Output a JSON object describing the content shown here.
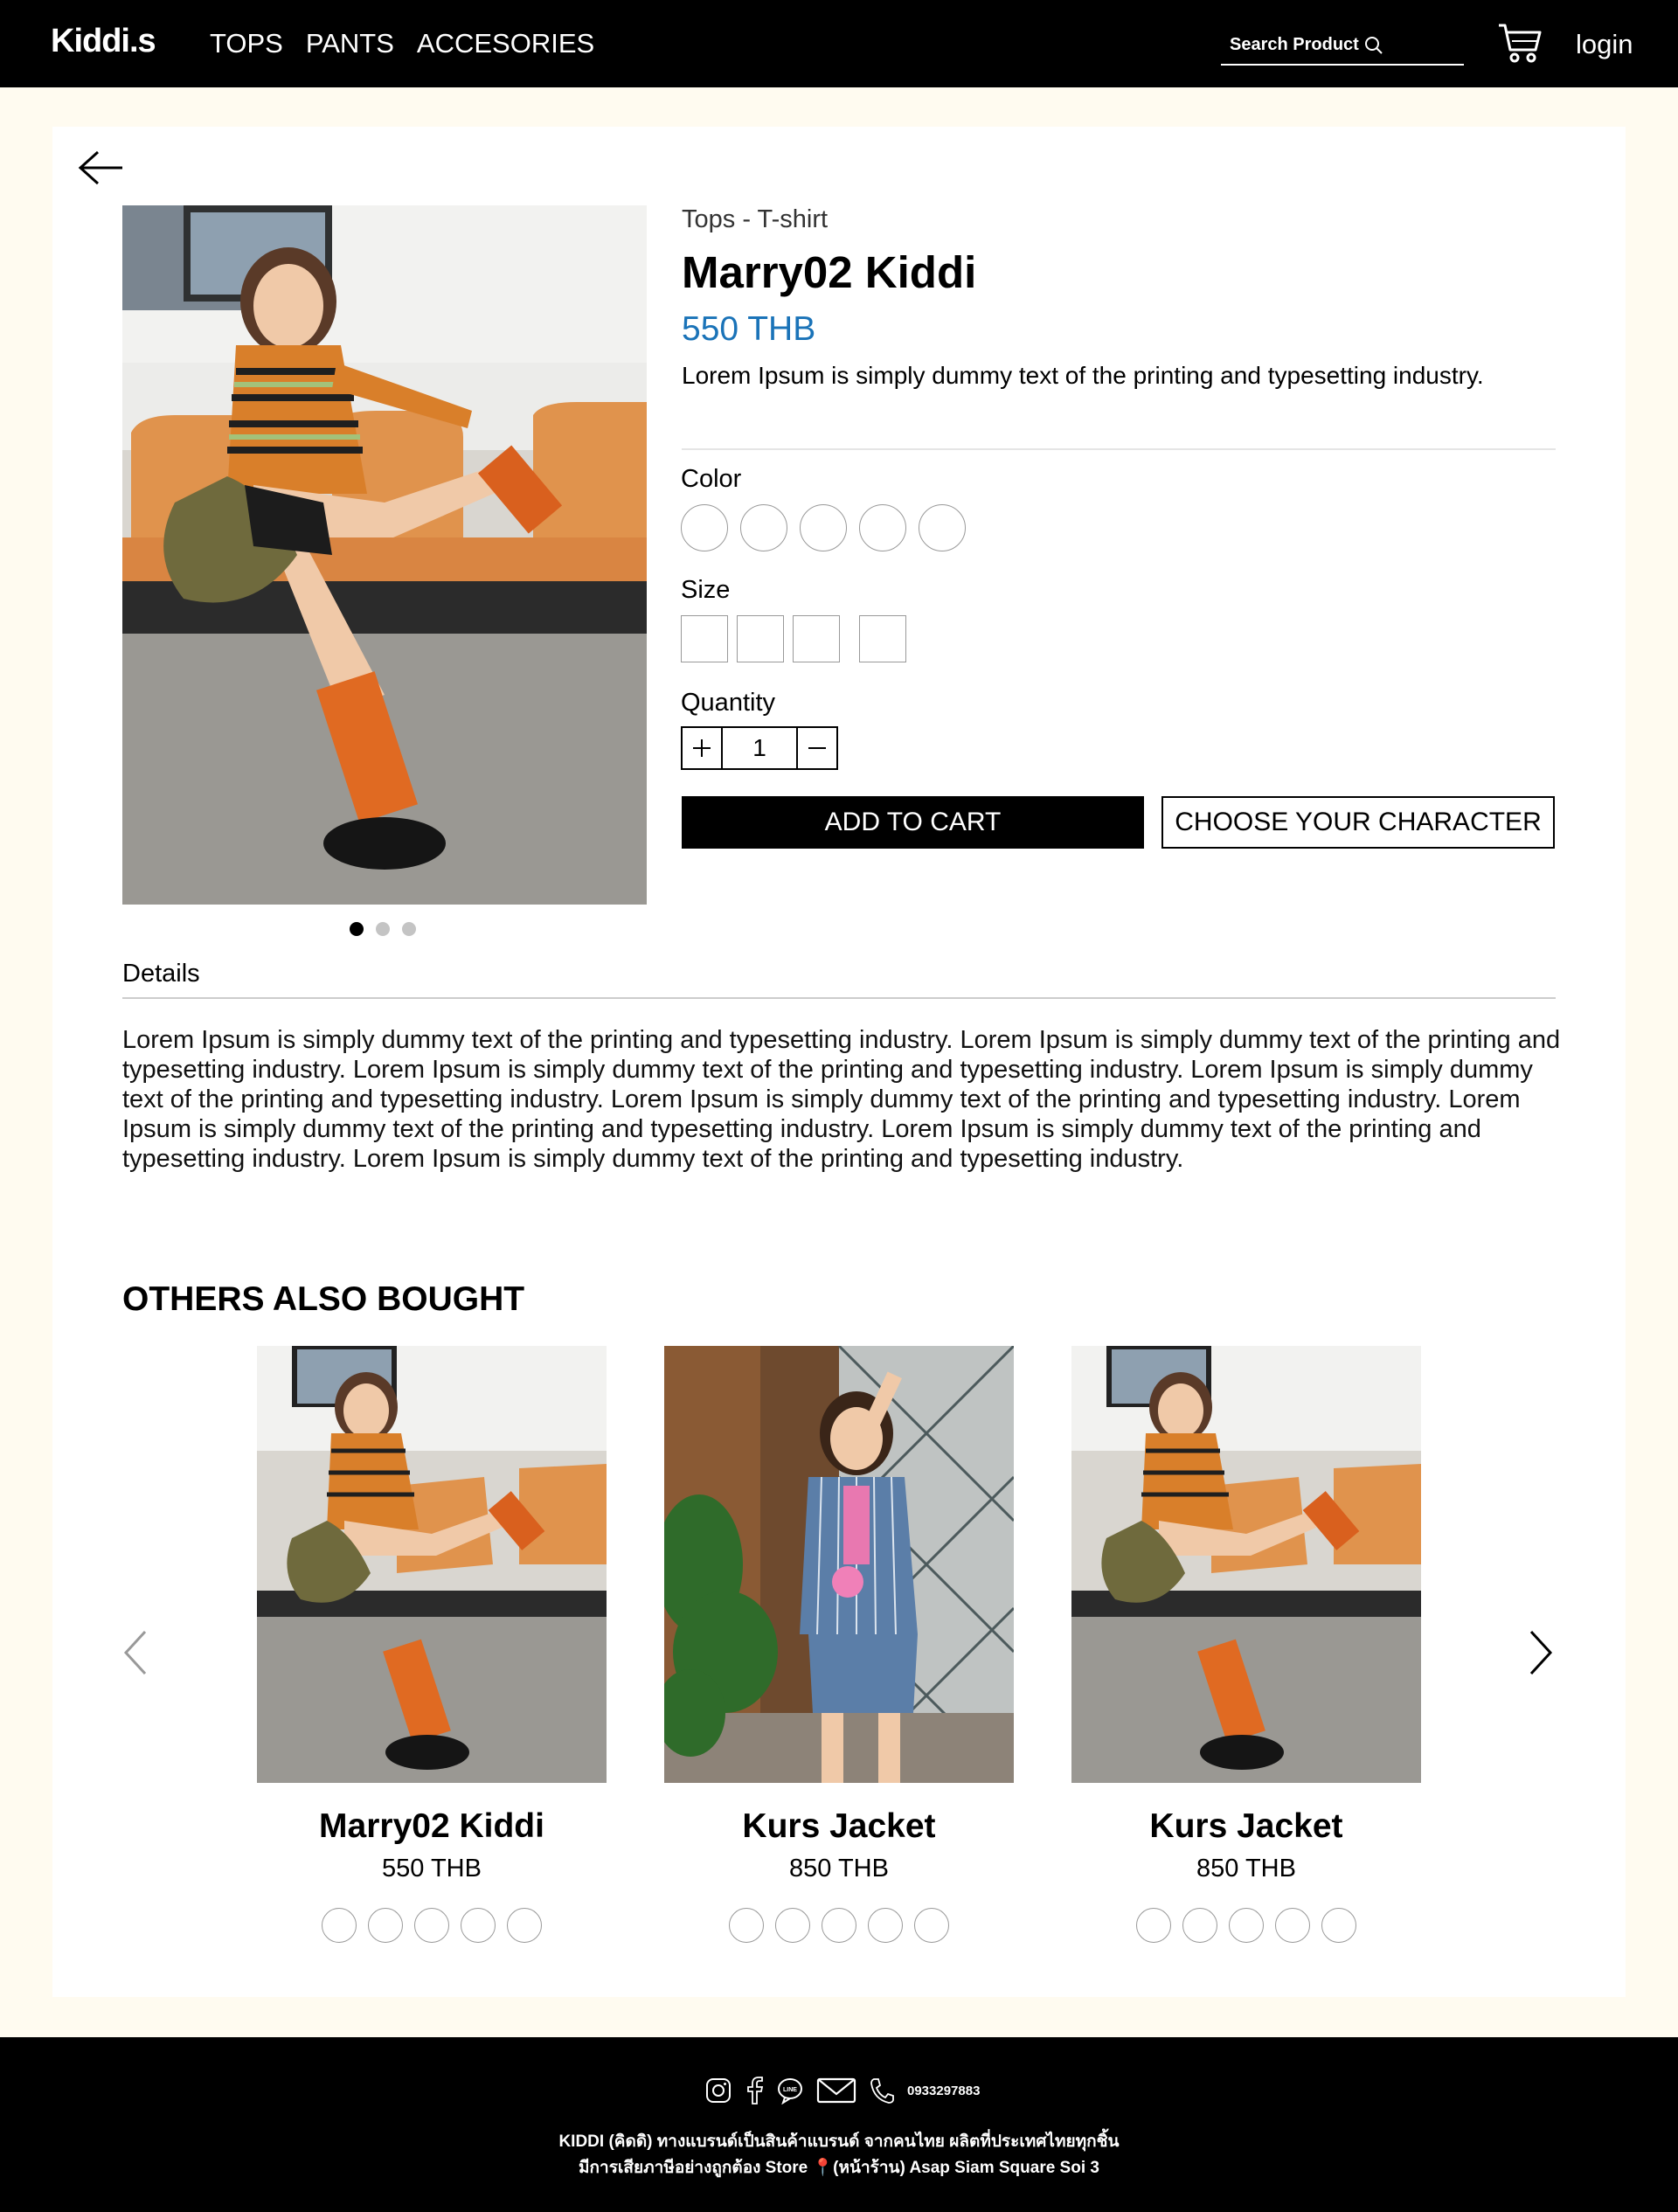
{
  "header": {
    "logo": "Kiddi.s",
    "nav": [
      "TOPS",
      "PANTS",
      "ACCESORIES"
    ],
    "search_placeholder": "Search Product",
    "login": "login"
  },
  "product": {
    "breadcrumb": "Tops - T-shirt",
    "title": "Marry02 Kiddi",
    "price": "550 THB",
    "description": "Lorem Ipsum is simply dummy text of the printing and typesetting industry.",
    "color_label": "Color",
    "size_label": "Size",
    "quantity_label": "Quantity",
    "quantity": "1",
    "add_to_cart": "ADD TO CART",
    "choose_character": "CHOOSE YOUR CHARACTER",
    "gallery_count": 3,
    "gallery_active": 1
  },
  "details": {
    "label": "Details",
    "text": "Lorem Ipsum is simply dummy text of the printing and typesetting industry. Lorem Ipsum is simply dummy text of the printing and typesetting industry. Lorem Ipsum is simply dummy text of the printing and typesetting industry. Lorem Ipsum is simply dummy text of the printing and typesetting industry. Lorem Ipsum is simply dummy text of the printing and typesetting industry. Lorem Ipsum is simply dummy text of the printing and typesetting industry. Lorem Ipsum is simply dummy text of the printing and typesetting industry. Lorem Ipsum is simply dummy text of the printing and typesetting industry."
  },
  "others": {
    "title": "OTHERS ALSO BOUGHT",
    "items": [
      {
        "name": "Marry02 Kiddi",
        "price": "550 THB"
      },
      {
        "name": "Kurs Jacket",
        "price": "850 THB"
      },
      {
        "name": "Kurs Jacket",
        "price": "850 THB"
      }
    ]
  },
  "footer": {
    "phone": "0933297883",
    "line1": "KIDDI (คิดดิ) ทางแบรนด์เป็นสินค้าแบรนด์ จากคนไทย ผลิตที่ประเทศไทยทุกชิ้น",
    "line2": "มีการเสียภาษีอย่างถูกต้อง Store 📍(หน้าร้าน) Asap Siam Square Soi 3"
  },
  "colors": {
    "header_bg": "#000000",
    "page_bg": "#fffbf0",
    "price_blue": "#1a73b8"
  }
}
